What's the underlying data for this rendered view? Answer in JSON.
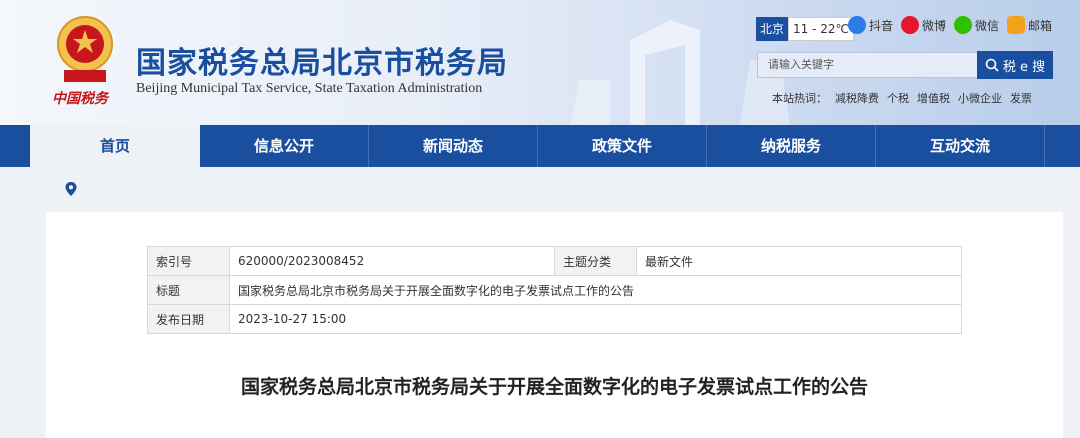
{
  "header": {
    "emblem_label": "中国税务",
    "title": "国家税务总局北京市税务局",
    "subtitle": "Beijing Municipal Tax Service, State Taxation Administration",
    "weather": {
      "city": "北京",
      "temp": "11 - 22℃"
    },
    "social": [
      {
        "label": "抖音",
        "icon": "douyin-icon",
        "color": "#111111"
      },
      {
        "label": "微博",
        "icon": "weibo-icon",
        "color": "#e6162d"
      },
      {
        "label": "微信",
        "icon": "wechat-icon",
        "color": "#2dc100"
      },
      {
        "label": "邮箱",
        "icon": "mail-icon",
        "color": "#f4a21b"
      }
    ],
    "search": {
      "placeholder": "请输入关键字",
      "button_label": "税 e 搜"
    },
    "hot": {
      "label": "本站热词：",
      "words": [
        "减税降费",
        "个税",
        "增值税",
        "小微企业",
        "发票"
      ]
    }
  },
  "nav": [
    "首页",
    "信息公开",
    "新闻动态",
    "政策文件",
    "纳税服务",
    "互动交流"
  ],
  "meta": {
    "index_label": "索引号",
    "index_value": "620000/2023008452",
    "category_label": "主题分类",
    "category_value": "最新文件",
    "title_label": "标题",
    "title_value": "国家税务总局北京市税务局关于开展全面数字化的电子发票试点工作的公告",
    "date_label": "发布日期",
    "date_value": "2023-10-27 15:00"
  },
  "document": {
    "title": "国家税务总局北京市税务局关于开展全面数字化的电子发票试点工作的公告"
  },
  "colors": {
    "brand": "#1a4fa0",
    "emblem_red": "#c8161d"
  }
}
